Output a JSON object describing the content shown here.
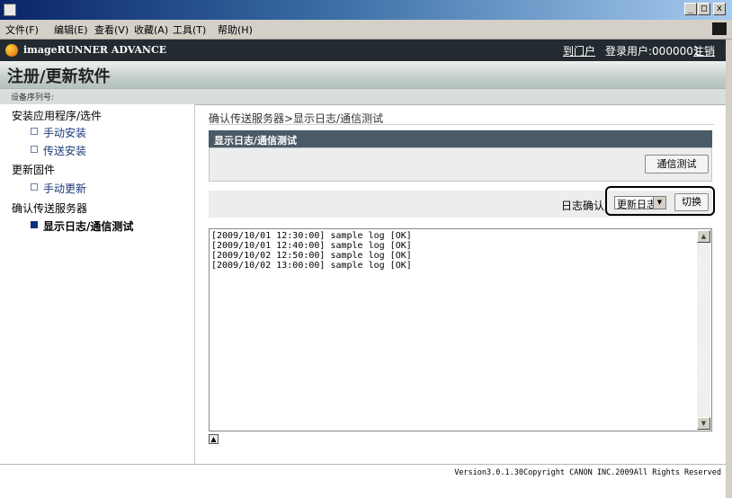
{
  "window": {
    "min": "_",
    "max": "□",
    "close": "x"
  },
  "menubar": {
    "items": [
      "文件(F)",
      "编辑(E)",
      "查看(V)",
      "收藏(A)",
      "工具(T)",
      "帮助(H)"
    ]
  },
  "header": {
    "brand": "imageRUNNER ADVANCE",
    "portal_link": "到门户",
    "user_label": "登录用户:0000001",
    "logout_link": "注销",
    "page_title": "注册/更新软件",
    "serial_label": "设备序列号:"
  },
  "sidebar": {
    "sections": [
      {
        "label": "安装应用程序/选件",
        "items": [
          "手动安装",
          "传送安装"
        ]
      },
      {
        "label": "更新固件",
        "items": [
          "手动更新"
        ]
      },
      {
        "label": "确认传送服务器",
        "items": [
          "显示日志/通信测试"
        ]
      }
    ]
  },
  "main": {
    "breadcrumb": "确认传送服务器>显示日志/通信测试",
    "panel_title": "显示日志/通信测试",
    "comm_test_button": "通信测试",
    "log_confirm_label": "日志确认:",
    "log_select_value": "更新日志",
    "switch_button": "切换",
    "log_lines": [
      "[2009/10/01 12:30:00] sample log [OK]",
      "[2009/10/01 12:40:00] sample log [OK]",
      "[2009/10/02 12:50:00] sample log [OK]",
      "[2009/10/02 13:00:00] sample log [OK]"
    ]
  },
  "footer": {
    "copyright": "Version3.0.1.30Copyright CANON INC.2009All Rights Reserved"
  },
  "icons": {
    "app": "app-icon",
    "logo": "canon-logo-icon",
    "select_arrow": "chevron-down-icon",
    "scroll_up": "scroll-up-icon",
    "scroll_down": "scroll-down-icon",
    "to_top": "page-top-icon"
  },
  "colors": {
    "brandbar": "#232b30",
    "panel_header": "#4a5a66",
    "active_bullet": "#0b2f7a",
    "link": "#1a3a78"
  }
}
